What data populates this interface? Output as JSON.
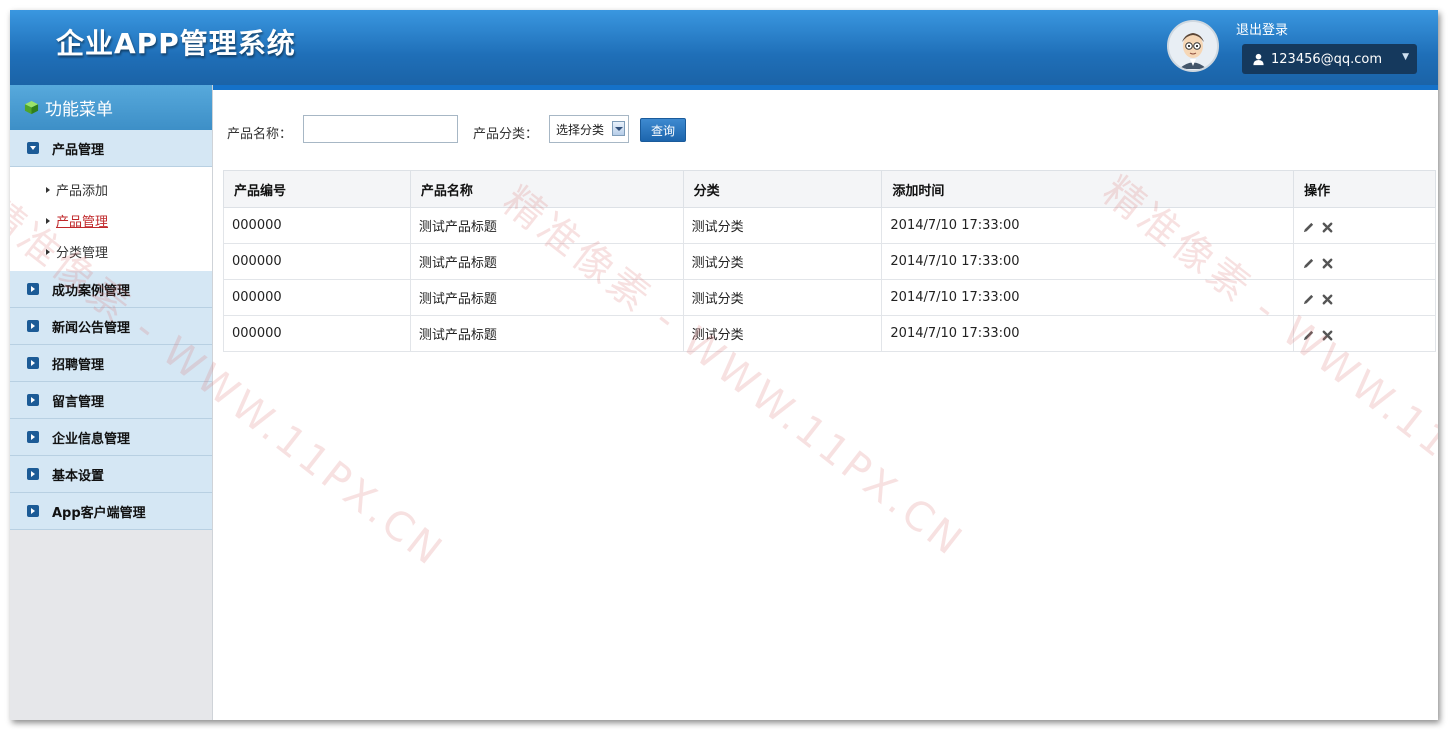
{
  "header": {
    "title": "企业APP管理系统",
    "logout_label": "退出登录",
    "user_email": "123456@qq.com"
  },
  "sidebar": {
    "menu_title": "功能菜单",
    "expanded_group": {
      "label": "产品管理",
      "items": [
        {
          "label": "产品添加"
        },
        {
          "label": "产品管理"
        },
        {
          "label": "分类管理"
        }
      ]
    },
    "groups": [
      {
        "label": "成功案例管理"
      },
      {
        "label": "新闻公告管理"
      },
      {
        "label": "招聘管理"
      },
      {
        "label": "留言管理"
      },
      {
        "label": "企业信息管理"
      },
      {
        "label": "基本设置"
      },
      {
        "label": "App客户端管理"
      }
    ]
  },
  "search": {
    "name_label": "产品名称：",
    "name_value": "",
    "category_label": "产品分类：",
    "category_selected": "选择分类",
    "query_label": "查询"
  },
  "table": {
    "headers": [
      "产品编号",
      "产品名称",
      "分类",
      "添加时间",
      "操作"
    ],
    "rows": [
      {
        "id": "000000",
        "name": "测试产品标题",
        "category": "测试分类",
        "time": "2014/7/10 17:33:00"
      },
      {
        "id": "000000",
        "name": "测试产品标题",
        "category": "测试分类",
        "time": "2014/7/10 17:33:00"
      },
      {
        "id": "000000",
        "name": "测试产品标题",
        "category": "测试分类",
        "time": "2014/7/10 17:33:00"
      },
      {
        "id": "000000",
        "name": "测试产品标题",
        "category": "测试分类",
        "time": "2014/7/10 17:33:00"
      }
    ]
  },
  "watermark": "精准像素 - WWW.11PX.CN",
  "colors": {
    "header": "#1f6fb8",
    "user_dropdown": "#15395d",
    "sidebar_group": "#d5e7f4",
    "active_link": "#c0282b",
    "query_button": "#1c65ad"
  }
}
